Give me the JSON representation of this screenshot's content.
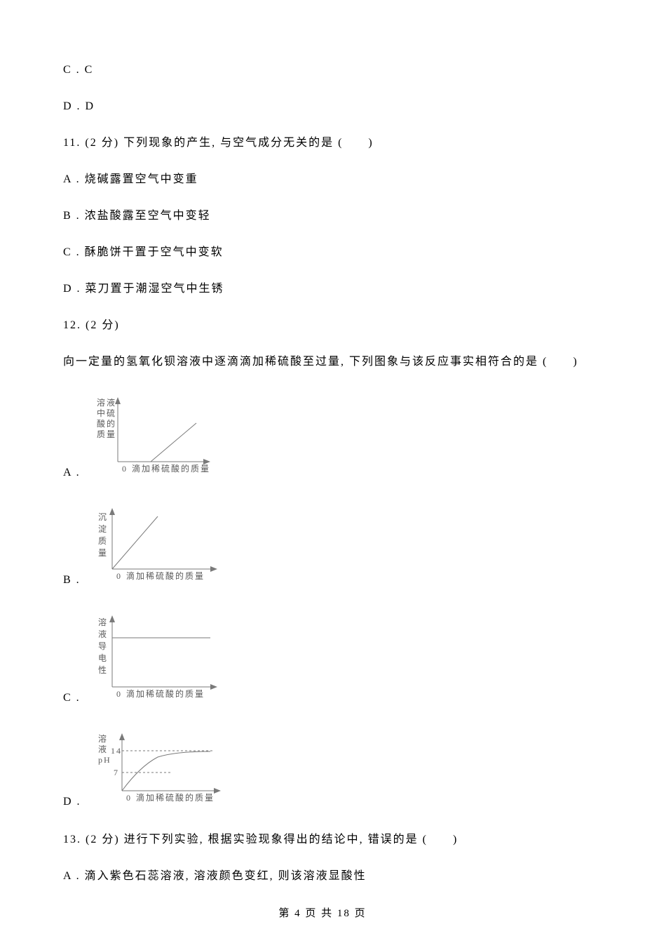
{
  "prev_options": {
    "c": "C . C",
    "d": "D . D"
  },
  "q11": {
    "stem": "11.  (2 分) 下列现象的产生, 与空气成分无关的是 (　　)",
    "a": "A . 烧碱露置空气中变重",
    "b": "B . 浓盐酸露至空气中变轻",
    "c": "C . 酥脆饼干置于空气中变软",
    "d": "D . 菜刀置于潮湿空气中生锈"
  },
  "q12": {
    "num": "12.  (2 分)",
    "stem": "向一定量的氢氧化钡溶液中逐滴滴加稀硫酸至过量, 下列图象与该反应事实相符合的是 (　　)",
    "a": "A .",
    "b": "B .",
    "c": "C .",
    "d": "D .",
    "chartA": {
      "ylabel": "溶液\n中硫\n酸的\n质量",
      "xlabel": "滴加稀硫酸的质量",
      "zero": "0"
    },
    "chartB": {
      "ylabel": "沉\n淀\n质\n量",
      "xlabel": "滴加稀硫酸的质量",
      "zero": "0"
    },
    "chartC": {
      "ylabel": "溶\n液\n导\n电\n性",
      "xlabel": "滴加稀硫酸的质量",
      "zero": "0"
    },
    "chartD": {
      "ylabel": "溶\n液\npH",
      "xlabel": "滴加稀硫酸的质量",
      "zero": "0",
      "tick14": "14",
      "tick7": "7"
    }
  },
  "q13": {
    "stem": "13.  (2 分) 进行下列实验, 根据实验现象得出的结论中, 错误的是 (　　)",
    "a": "A . 滴入紫色石蕊溶液, 溶液颜色变红, 则该溶液显酸性"
  },
  "footer": "第 4 页 共 18 页",
  "chart_data": [
    {
      "type": "line",
      "title": "Option A",
      "xlabel": "滴加稀硫酸的质量",
      "ylabel": "溶液中硫酸的质量",
      "x": [
        0,
        40,
        100
      ],
      "y": [
        0,
        0,
        60
      ]
    },
    {
      "type": "line",
      "title": "Option B",
      "xlabel": "滴加稀硫酸的质量",
      "ylabel": "沉淀质量",
      "x": [
        0,
        100
      ],
      "y": [
        0,
        100
      ]
    },
    {
      "type": "line",
      "title": "Option C",
      "xlabel": "滴加稀硫酸的质量",
      "ylabel": "溶液导电性",
      "x": [
        0,
        100
      ],
      "y": [
        60,
        60
      ]
    },
    {
      "type": "line",
      "title": "Option D",
      "xlabel": "滴加稀硫酸的质量",
      "ylabel": "溶液pH",
      "x": [
        0,
        30,
        60,
        100
      ],
      "y": [
        0,
        12,
        13.5,
        14
      ],
      "ylim": [
        0,
        14
      ],
      "yticks": [
        7,
        14
      ]
    }
  ]
}
